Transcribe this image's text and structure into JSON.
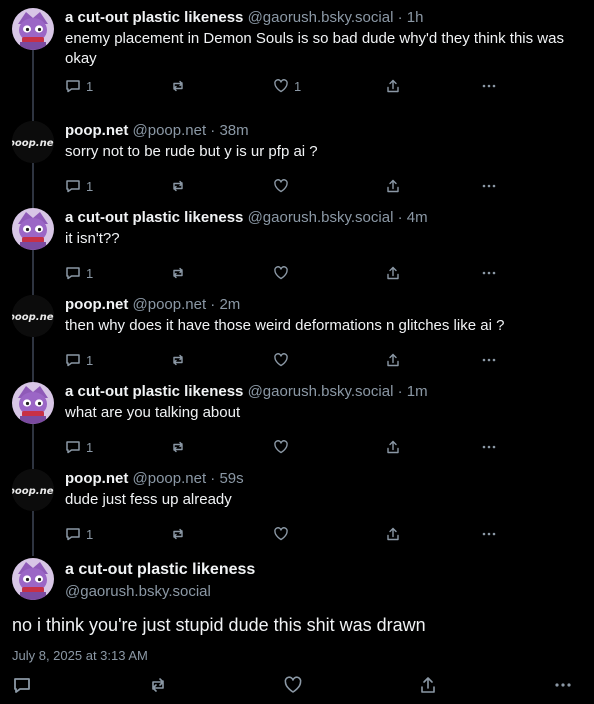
{
  "thread": [
    {
      "avatar": "purple-figure",
      "name": "a cut-out plastic likeness",
      "handle": "@gaorush.bsky.social",
      "time": "1h",
      "text": "enemy placement in Demon Souls is so bad dude why'd they think this was okay",
      "replies": "1",
      "likes": "1"
    },
    {
      "avatar": "poop-net",
      "name": "poop.net",
      "handle": "@poop.net",
      "time": "38m",
      "text": "sorry not to be rude but y is ur pfp ai ?",
      "replies": "1",
      "likes": ""
    },
    {
      "avatar": "purple-figure",
      "name": "a cut-out plastic likeness",
      "handle": "@gaorush.bsky.social",
      "time": "4m",
      "text": "it isn't??",
      "replies": "1",
      "likes": ""
    },
    {
      "avatar": "poop-net",
      "name": "poop.net",
      "handle": "@poop.net",
      "time": "2m",
      "text": "then why does it have those weird deformations n glitches like ai ?",
      "replies": "1",
      "likes": ""
    },
    {
      "avatar": "purple-figure",
      "name": "a cut-out plastic likeness",
      "handle": "@gaorush.bsky.social",
      "time": "1m",
      "text": "what are you talking about",
      "replies": "1",
      "likes": ""
    },
    {
      "avatar": "poop-net",
      "name": "poop.net",
      "handle": "@poop.net",
      "time": "59s",
      "text": "dude just fess up already",
      "replies": "1",
      "likes": ""
    }
  ],
  "separator": " · ",
  "avatar_text": "poop.net",
  "main_post": {
    "name": "a cut-out plastic likeness",
    "handle": "@gaorush.bsky.social",
    "text": "no i think you're just stupid dude this shit was drawn",
    "date": "July 8, 2025 at 3:13 AM"
  },
  "colors": {
    "background": "#000000",
    "text": "#f1f3f5",
    "muted": "#8b98a5",
    "thread_line": "#2e3440"
  },
  "icons": {
    "reply": "reply-icon",
    "repost": "repost-icon",
    "like": "heart-icon",
    "share": "share-icon",
    "more": "more-icon"
  }
}
